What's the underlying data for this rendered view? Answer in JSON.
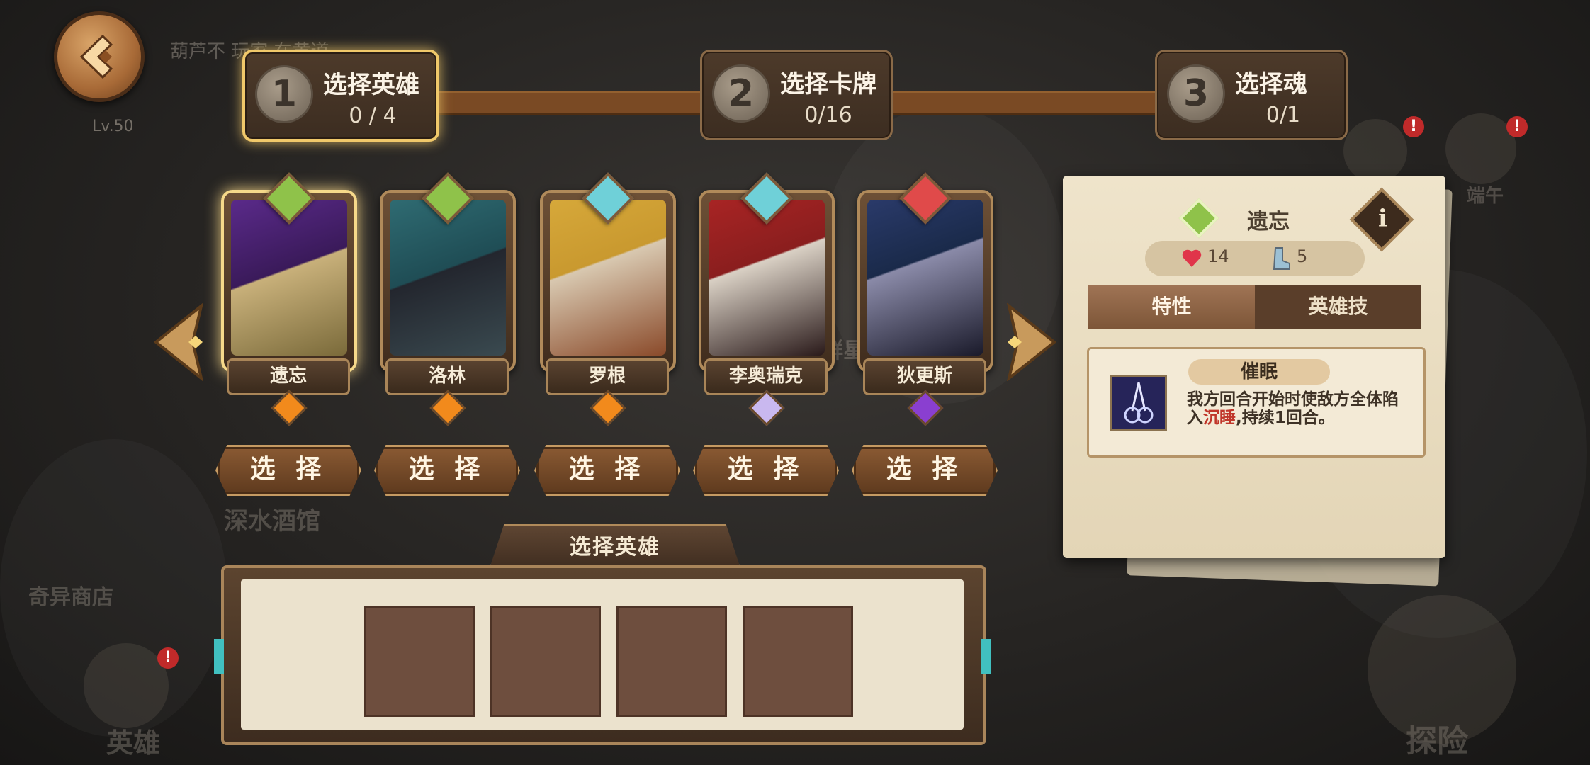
{
  "background": {
    "ticker_text": "葫芦不 玩家 在黄道",
    "labels": {
      "tavern": "深水酒馆",
      "shop": "奇异商店",
      "heroes": "英雄",
      "explore": "探险",
      "sign": "端午",
      "star": "群星"
    }
  },
  "player": {
    "level": "Lv.50"
  },
  "steps": [
    {
      "number": "1",
      "title": "选择英雄",
      "count": "0 / 4",
      "active": true
    },
    {
      "number": "2",
      "title": "选择卡牌",
      "count": "0/16",
      "active": false
    },
    {
      "number": "3",
      "title": "选择魂",
      "count": "0/1",
      "active": false
    }
  ],
  "heroes": [
    {
      "name": "遗忘",
      "gem_color": "#8fc24a",
      "rarity_color": "#f28a1c",
      "art": [
        "#5a2a8a",
        "#c8b07a"
      ],
      "selected": true
    },
    {
      "name": "洛林",
      "gem_color": "#8fc24a",
      "rarity_color": "#f28a1c",
      "art": [
        "#1f4d55",
        "#2a2f38"
      ],
      "selected": false
    },
    {
      "name": "罗根",
      "gem_color": "#6fd0d8",
      "rarity_color": "#f28a1c",
      "art": [
        "#c9992f",
        "#8a4a2a"
      ],
      "selected": false
    },
    {
      "name": "李奥瑞克",
      "gem_color": "#6fd0d8",
      "rarity_color": "#c9b8ef",
      "art": [
        "#8a1e1e",
        "#2a1a1a"
      ],
      "selected": false
    },
    {
      "name": "狄更斯",
      "gem_color": "#e04a4a",
      "rarity_color": "#8a3fd0",
      "art": [
        "#1a2a4a",
        "#5c6a9a"
      ],
      "selected": false
    }
  ],
  "select_label": "选 择",
  "detail": {
    "name": "遗忘",
    "info_label": "i",
    "hp": "14",
    "cost": "5",
    "tabs": {
      "traits": "特性",
      "skill": "英雄技"
    },
    "skill_name": "催眠",
    "skill_desc_before": "我方回合开始时使敌方全体陷入",
    "skill_keyword": "沉睡",
    "skill_desc_after": ",持续1回合。"
  },
  "tray": {
    "title": "选择英雄",
    "slots": 4
  }
}
